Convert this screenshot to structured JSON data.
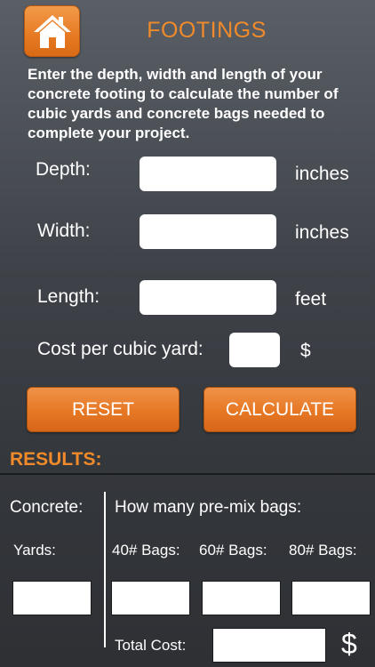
{
  "header": {
    "home_icon": "house-icon",
    "title": "FOOTINGS"
  },
  "intro_text": "Enter the depth, width and length of your concrete footing to calculate the number of cubic yards and concrete bags needed to complete your project.",
  "form": {
    "depth": {
      "label": "Depth:",
      "unit": "inches",
      "value": ""
    },
    "width": {
      "label": "Width:",
      "unit": "inches",
      "value": ""
    },
    "length": {
      "label": "Length:",
      "unit": "feet",
      "value": ""
    },
    "cost": {
      "label": "Cost per cubic yard:",
      "unit": "$",
      "value": ""
    }
  },
  "buttons": {
    "reset": "RESET",
    "calculate": "CALCULATE"
  },
  "results": {
    "heading": "RESULTS:",
    "concrete_label": "Concrete:",
    "yards_label": "Yards:",
    "bags_heading": "How many pre-mix bags:",
    "bag40_label": "40# Bags:",
    "bag60_label": "60# Bags:",
    "bag80_label": "80# Bags:",
    "total_cost_label": "Total Cost:",
    "total_cost_symbol": "$",
    "yards_value": "",
    "bag40_value": "",
    "bag60_value": "",
    "bag80_value": "",
    "total_cost_value": ""
  },
  "colors": {
    "accent": "#f08a2a",
    "button": "#e67824",
    "background_top": "#5a5f66",
    "background_bottom": "#2e3034"
  }
}
